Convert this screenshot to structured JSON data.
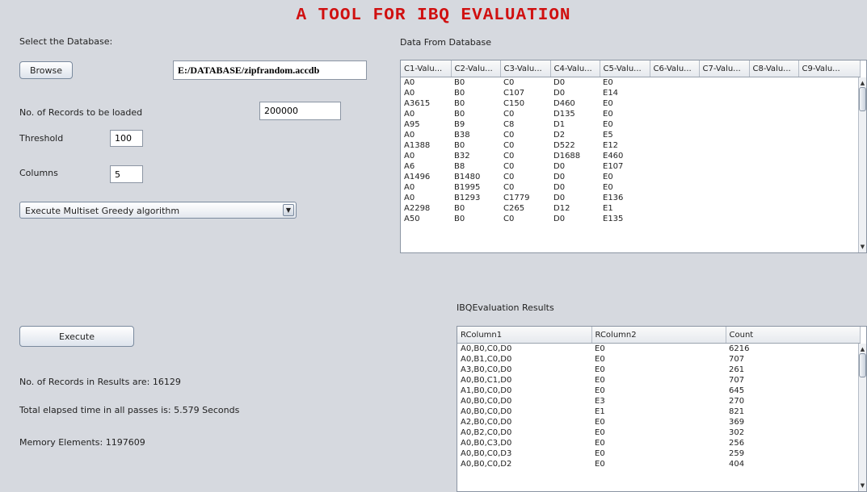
{
  "title": "A TOOL FOR IBQ EVALUATION",
  "left": {
    "select_db_label": "Select the Database:",
    "browse_label": "Browse",
    "db_path": "E:/DATABASE/zipfrandom.accdb",
    "records_label": "No. of Records to be loaded",
    "records_value": "200000",
    "threshold_label": "Threshold",
    "threshold_value": "100",
    "columns_label": "Columns",
    "columns_value": "5",
    "algorithm_selected": "Execute Multiset Greedy algorithm",
    "execute_label": "Execute",
    "results_count": "No. of Records in Results are: 16129",
    "elapsed_time": "Total elapsed time in all passes is: 5.579 Seconds",
    "memory_elements": "Memory Elements: 1197609"
  },
  "data_table": {
    "label": "Data From Database",
    "columns": [
      "C1-Valu...",
      "C2-Valu...",
      "C3-Valu...",
      "C4-Valu...",
      "C5-Valu...",
      "C6-Valu...",
      "C7-Valu...",
      "C8-Valu...",
      "C9-Valu..."
    ],
    "rows": [
      [
        "A0",
        "B0",
        "C0",
        "D0",
        "E0",
        "",
        "",
        "",
        ""
      ],
      [
        "A0",
        "B0",
        "C107",
        "D0",
        "E14",
        "",
        "",
        "",
        ""
      ],
      [
        "A3615",
        "B0",
        "C150",
        "D460",
        "E0",
        "",
        "",
        "",
        ""
      ],
      [
        "A0",
        "B0",
        "C0",
        "D135",
        "E0",
        "",
        "",
        "",
        ""
      ],
      [
        "A95",
        "B9",
        "C8",
        "D1",
        "E0",
        "",
        "",
        "",
        ""
      ],
      [
        "A0",
        "B38",
        "C0",
        "D2",
        "E5",
        "",
        "",
        "",
        ""
      ],
      [
        "A1388",
        "B0",
        "C0",
        "D522",
        "E12",
        "",
        "",
        "",
        ""
      ],
      [
        "A0",
        "B32",
        "C0",
        "D1688",
        "E460",
        "",
        "",
        "",
        ""
      ],
      [
        "A6",
        "B8",
        "C0",
        "D0",
        "E107",
        "",
        "",
        "",
        ""
      ],
      [
        "A1496",
        "B1480",
        "C0",
        "D0",
        "E0",
        "",
        "",
        "",
        ""
      ],
      [
        "A0",
        "B1995",
        "C0",
        "D0",
        "E0",
        "",
        "",
        "",
        ""
      ],
      [
        "A0",
        "B1293",
        "C1779",
        "D0",
        "E136",
        "",
        "",
        "",
        ""
      ],
      [
        "A2298",
        "B0",
        "C265",
        "D12",
        "E1",
        "",
        "",
        "",
        ""
      ],
      [
        "A50",
        "B0",
        "C0",
        "D0",
        "E135",
        "",
        "",
        "",
        ""
      ]
    ]
  },
  "results_table": {
    "label": "IBQEvaluation Results",
    "columns": [
      "RColumn1",
      "RColumn2",
      "Count"
    ],
    "rows": [
      [
        "A0,B0,C0,D0",
        "E0",
        "6216"
      ],
      [
        "A0,B1,C0,D0",
        "E0",
        "707"
      ],
      [
        "A3,B0,C0,D0",
        "E0",
        "261"
      ],
      [
        "A0,B0,C1,D0",
        "E0",
        "707"
      ],
      [
        "A1,B0,C0,D0",
        "E0",
        "645"
      ],
      [
        "A0,B0,C0,D0",
        "E3",
        "270"
      ],
      [
        "A0,B0,C0,D0",
        "E1",
        "821"
      ],
      [
        "A2,B0,C0,D0",
        "E0",
        "369"
      ],
      [
        "A0,B2,C0,D0",
        "E0",
        "302"
      ],
      [
        "A0,B0,C3,D0",
        "E0",
        "256"
      ],
      [
        "A0,B0,C0,D3",
        "E0",
        "259"
      ],
      [
        "A0,B0,C0,D2",
        "E0",
        "404"
      ]
    ]
  }
}
